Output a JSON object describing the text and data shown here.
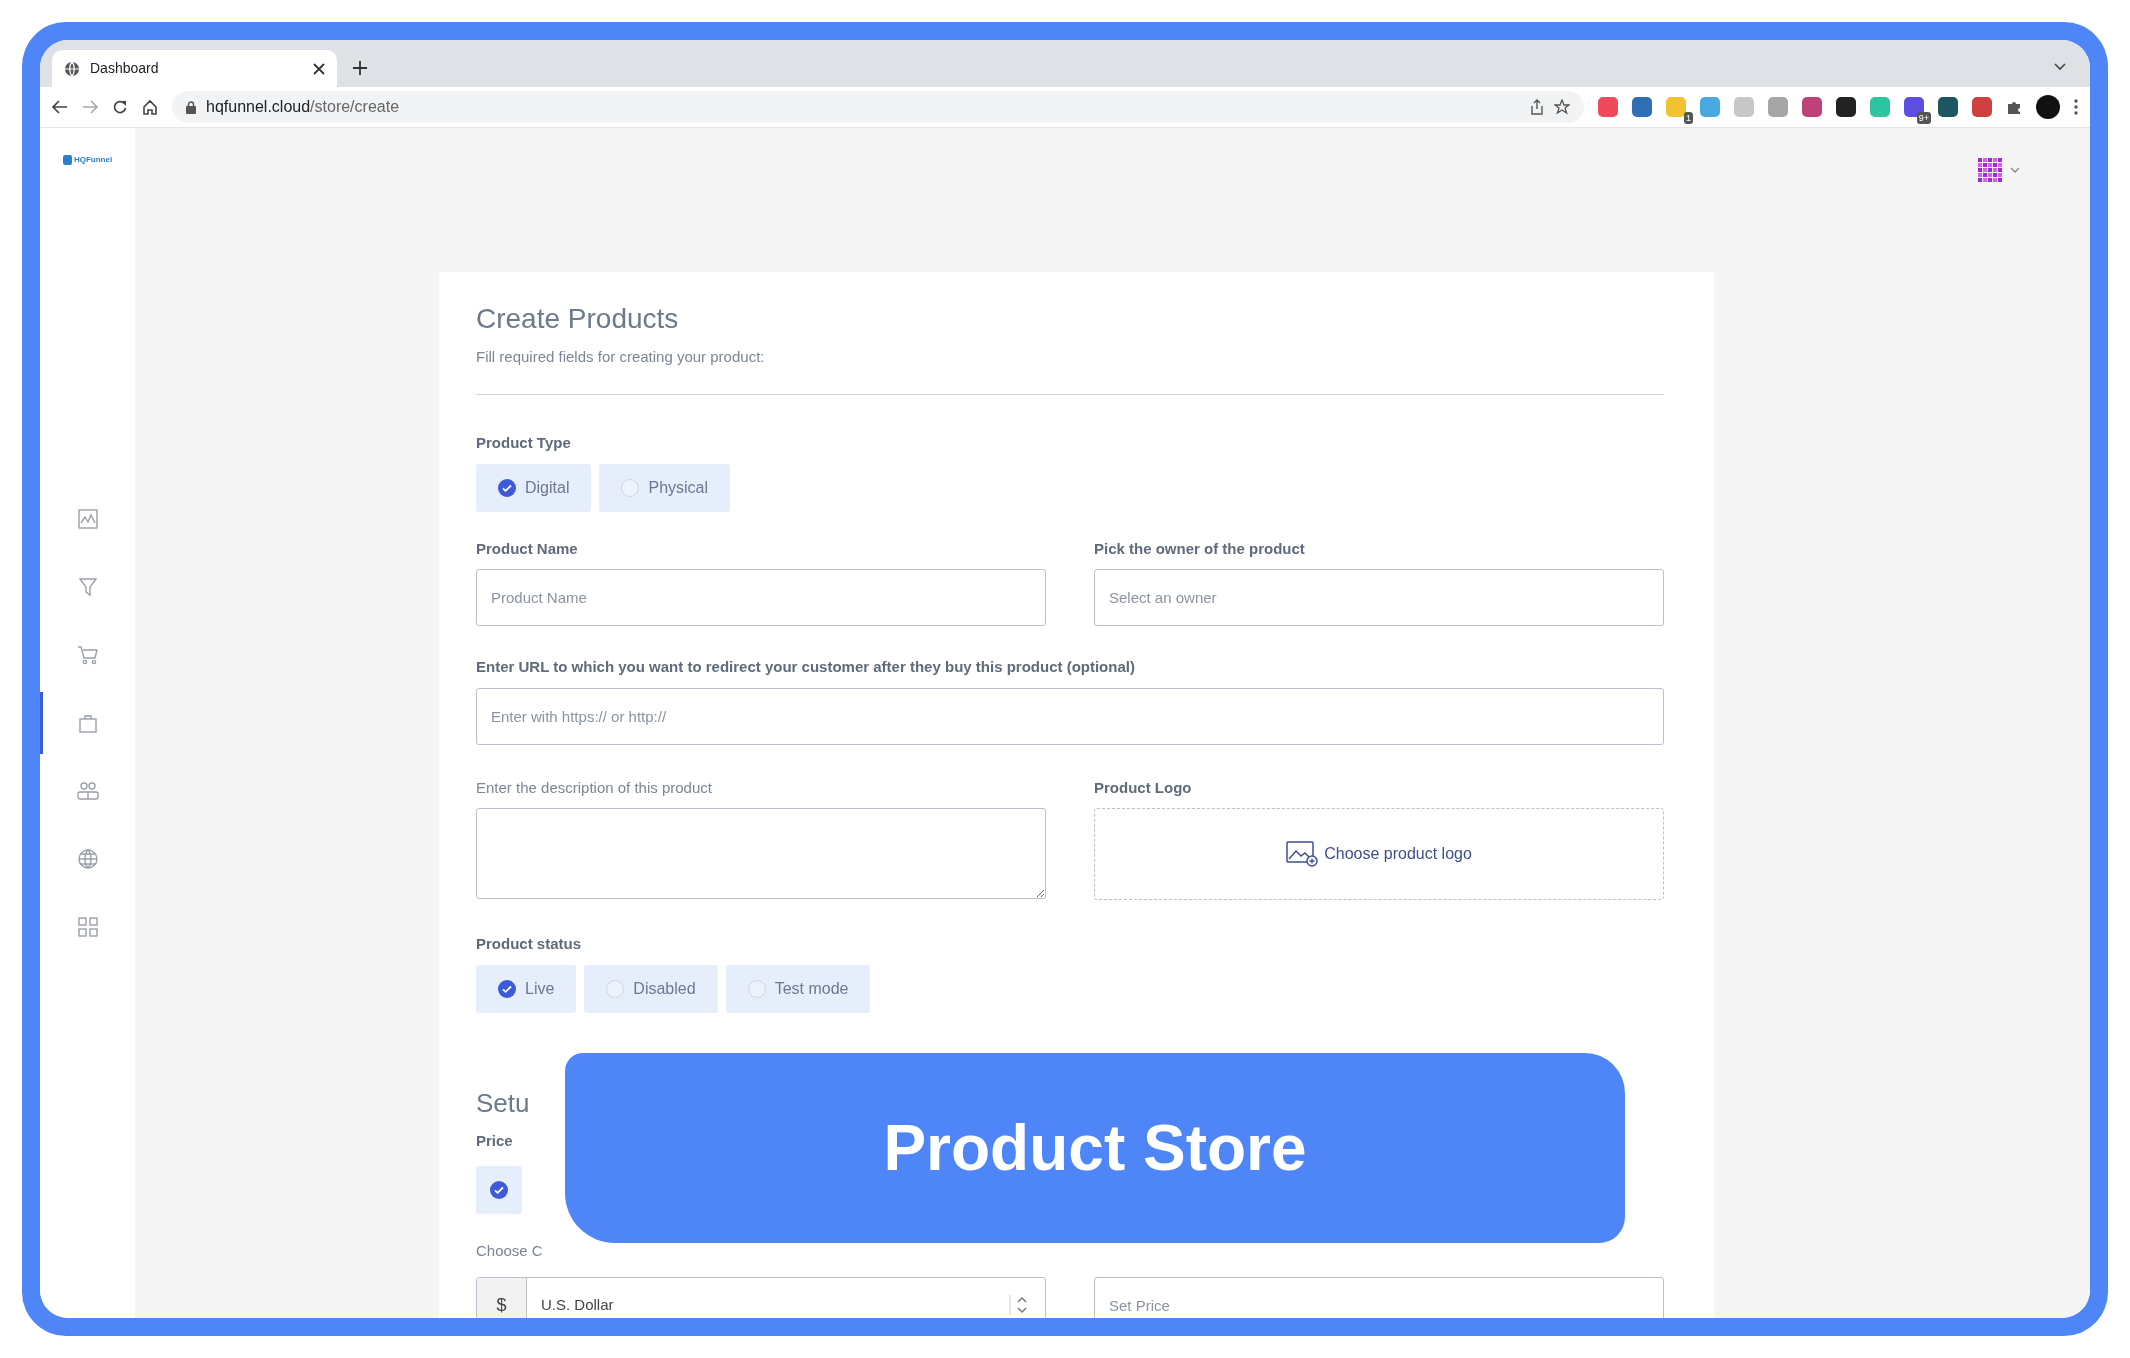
{
  "browser": {
    "tab_title": "Dashboard",
    "url_host": "hqfunnel.cloud",
    "url_path": "/store/create",
    "extensions": [
      {
        "color": "#ef4a5a"
      },
      {
        "color": "#2f6fb5"
      },
      {
        "color": "#f2c230",
        "badge": "1"
      },
      {
        "color": "#4aa8e0"
      },
      {
        "color": "#c8c8c8"
      },
      {
        "color": "#a6a6a6"
      },
      {
        "color": "#c0407a"
      },
      {
        "color": "#222222"
      },
      {
        "color": "#2fc4a0"
      },
      {
        "color": "#5b4ee0",
        "badge": "9+"
      },
      {
        "color": "#1d5560"
      },
      {
        "color": "#d04040"
      }
    ]
  },
  "app": {
    "logo_text": "HQFunnel"
  },
  "sidebar": {
    "items": [
      {
        "kind": "chart",
        "selected": false
      },
      {
        "kind": "funnel",
        "selected": false
      },
      {
        "kind": "cart",
        "selected": false
      },
      {
        "kind": "bag",
        "selected": true
      },
      {
        "kind": "users",
        "selected": false
      },
      {
        "kind": "globe",
        "selected": false
      },
      {
        "kind": "apps",
        "selected": false
      }
    ]
  },
  "form": {
    "title": "Create Products",
    "subtitle": "Fill required fields for creating your product:",
    "product_type": {
      "label": "Product Type",
      "options": [
        {
          "label": "Digital",
          "selected": true
        },
        {
          "label": "Physical",
          "selected": false
        }
      ]
    },
    "product_name": {
      "label": "Product Name",
      "placeholder": "Product Name"
    },
    "owner": {
      "label": "Pick the owner of the product",
      "placeholder": "Select an owner"
    },
    "redirect_url": {
      "label": "Enter URL to which you want to redirect your customer after they buy this product (optional)",
      "placeholder": "Enter with https:// or http://"
    },
    "description": {
      "label": "Enter the description of this product"
    },
    "logo": {
      "label": "Product Logo",
      "button": "Choose product logo"
    },
    "status": {
      "label": "Product status",
      "options": [
        {
          "label": "Live",
          "selected": true
        },
        {
          "label": "Disabled",
          "selected": false
        },
        {
          "label": "Test mode",
          "selected": false
        }
      ]
    },
    "setup_heading": "Setu",
    "price": {
      "label": "Price",
      "options": [
        {
          "selected": true
        }
      ]
    },
    "currency": {
      "label": "Choose C",
      "addon": "$",
      "value": "U.S. Dollar"
    },
    "set_price": {
      "placeholder": "Set Price"
    }
  },
  "overlay": {
    "text": "Product Store"
  }
}
